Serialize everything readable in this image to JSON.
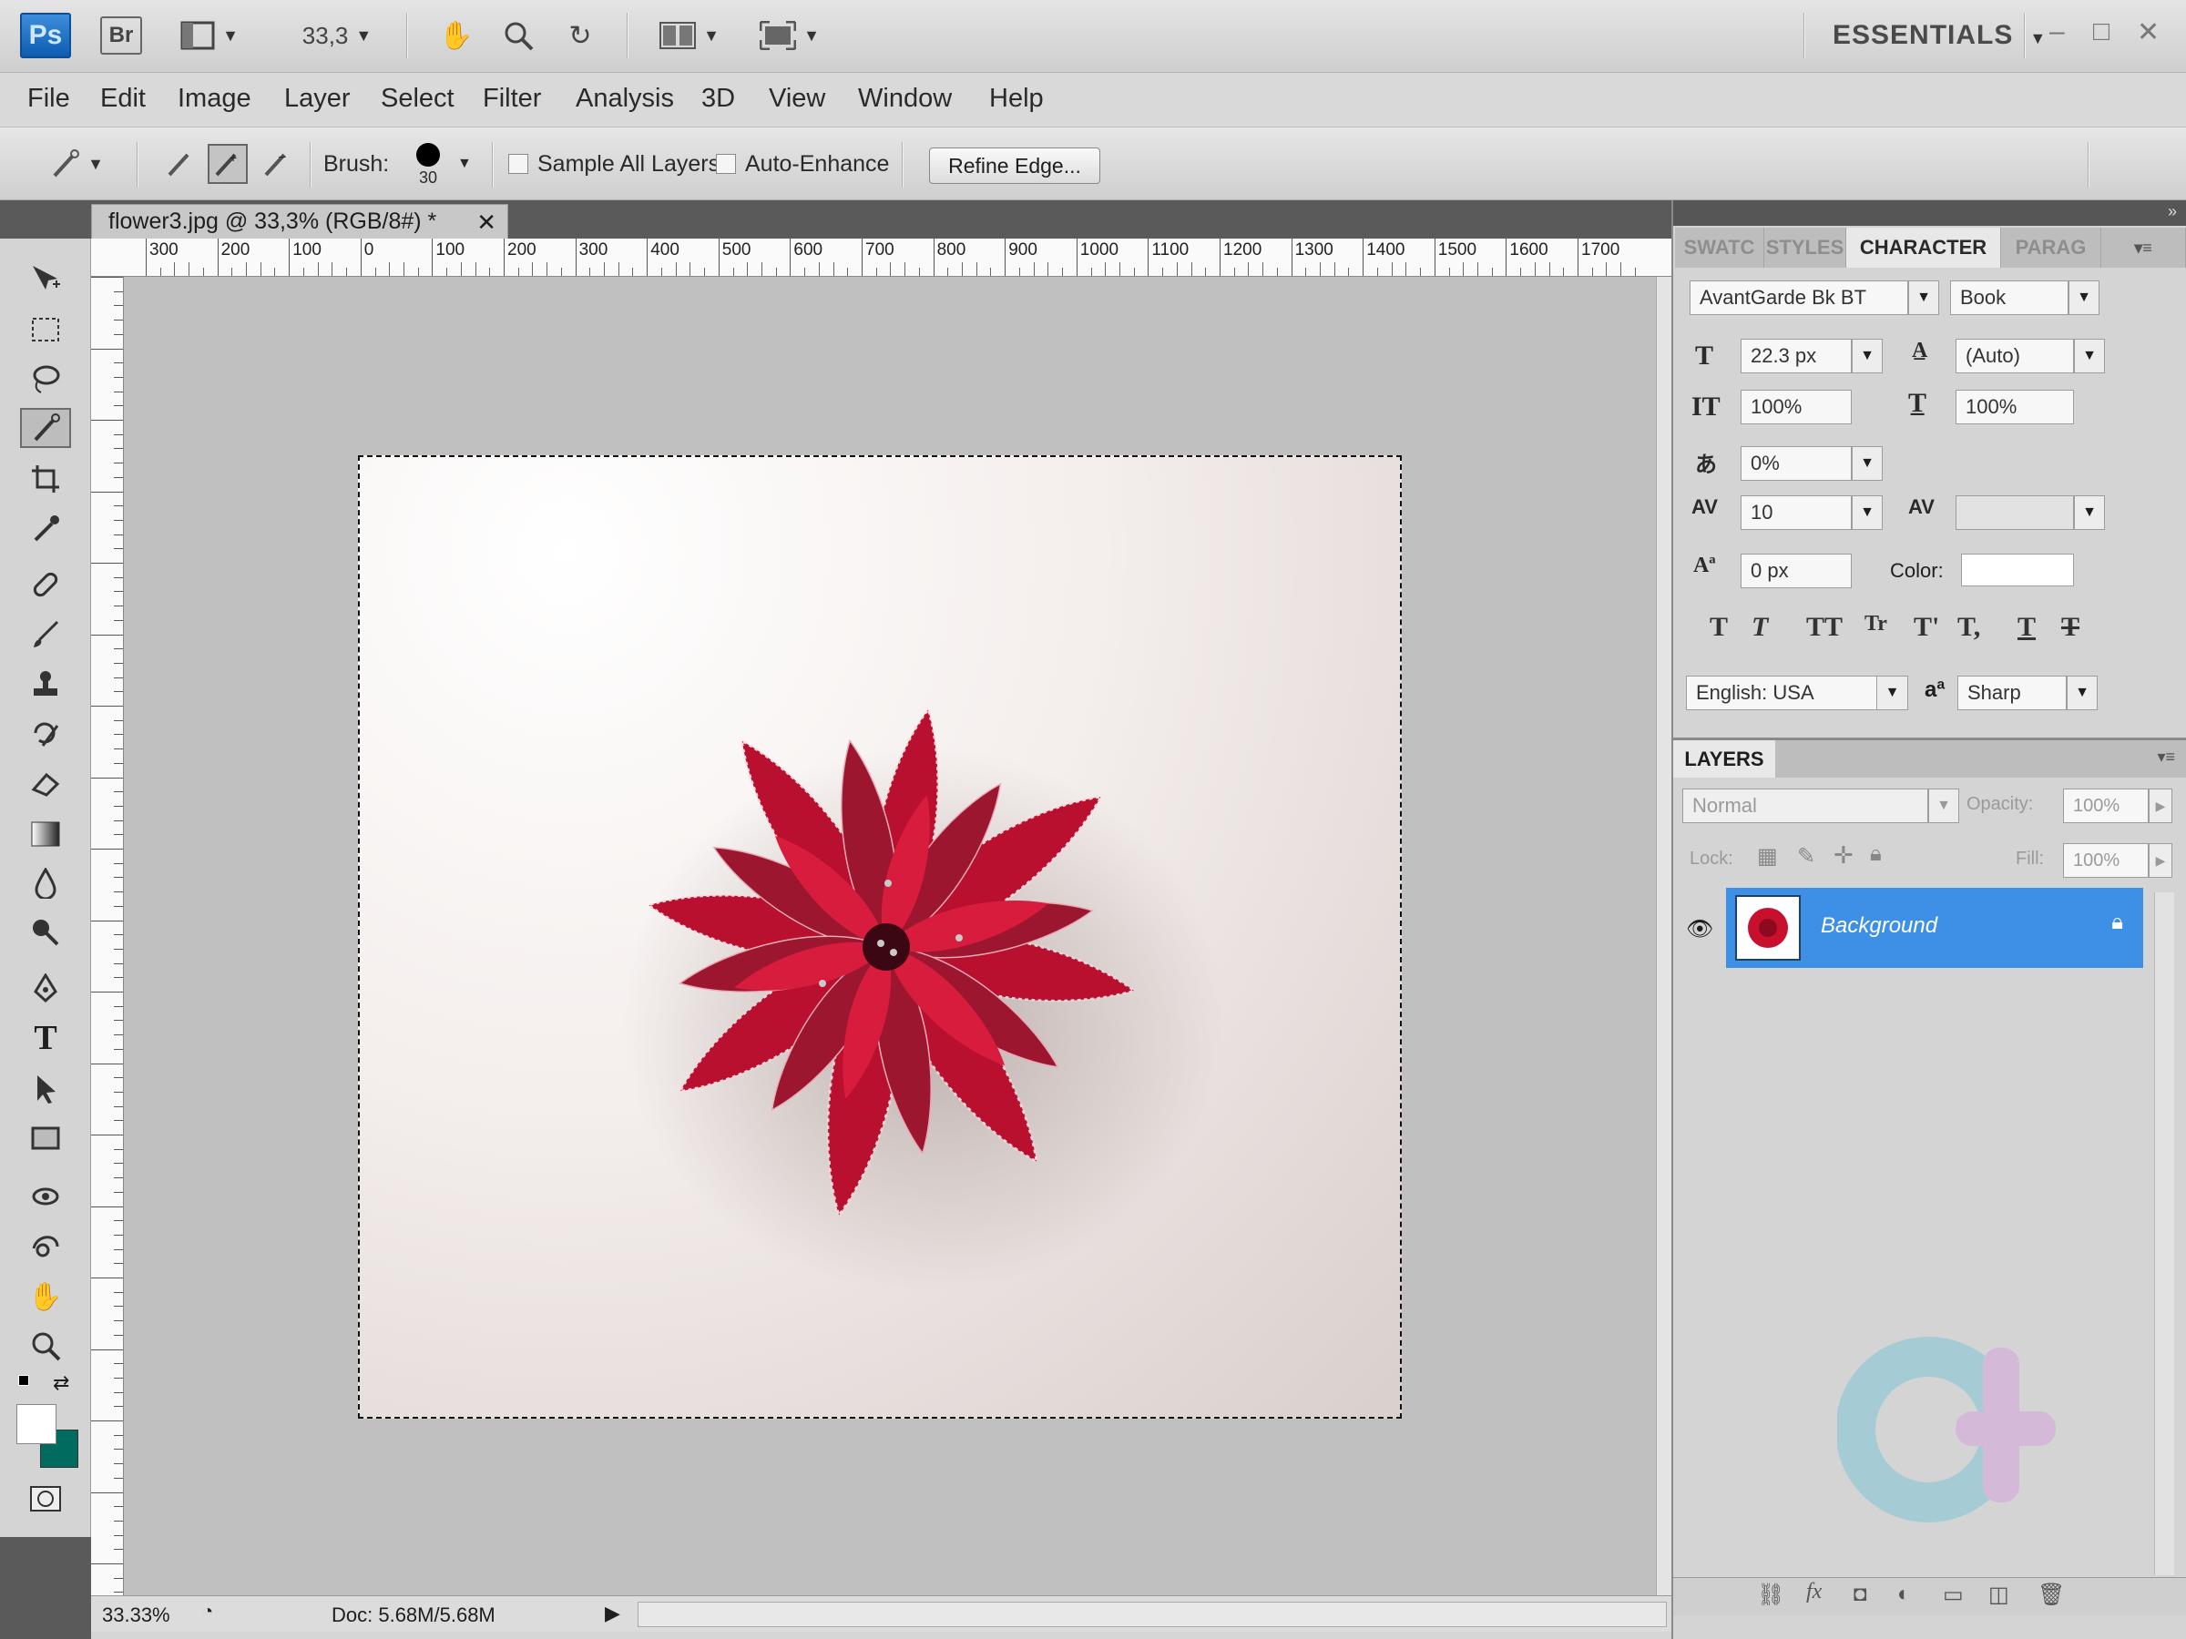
{
  "app": {
    "logo": "Ps",
    "bridge": "Br",
    "zoom": "33,3",
    "workspace": "ESSENTIALS"
  },
  "menu": [
    "File",
    "Edit",
    "Image",
    "Layer",
    "Select",
    "Filter",
    "Analysis",
    "3D",
    "View",
    "Window",
    "Help"
  ],
  "options": {
    "brush_label": "Brush:",
    "brush_size": "30",
    "sample_all_layers": "Sample All Layers",
    "auto_enhance": "Auto-Enhance",
    "refine_edge": "Refine Edge..."
  },
  "document": {
    "tab_title": "flower3.jpg @ 33,3% (RGB/8#) *",
    "ruler_h": [
      "300",
      "200",
      "100",
      "0",
      "100",
      "200",
      "300",
      "400",
      "500",
      "600",
      "700",
      "800",
      "900",
      "1000",
      "1100",
      "1200",
      "1300",
      "1400",
      "1500",
      "1600",
      "1700"
    ],
    "zoom": "33.33%",
    "doc_size": "Doc: 5.68M/5.68M"
  },
  "character": {
    "tabs": [
      "SWATC",
      "STYLES",
      "CHARACTER",
      "PARAG"
    ],
    "font_family": "AvantGarde Bk BT",
    "font_style": "Book",
    "size": "22.3 px",
    "leading": "(Auto)",
    "vertical_scale": "100%",
    "horizontal_scale": "100%",
    "tsume": "0%",
    "tracking": "10",
    "kerning": "",
    "baseline_shift": "0 px",
    "color_label": "Color:",
    "format_buttons": [
      "T",
      "T",
      "TT",
      "Tr",
      "T'",
      "T,",
      "T",
      "T"
    ],
    "language": "English: USA",
    "antialias_label": "a",
    "antialias": "Sharp"
  },
  "layers": {
    "title": "LAYERS",
    "blend": "Normal",
    "opacity_label": "Opacity:",
    "opacity": "100%",
    "lock_label": "Lock:",
    "fill_label": "Fill:",
    "fill": "100%",
    "items": [
      {
        "name": "Background"
      }
    ]
  },
  "colors": {
    "accent": "#3e8fe6",
    "flower_red": "#d41a3a",
    "fg": "#ffffff",
    "bg": "#006b5e"
  }
}
